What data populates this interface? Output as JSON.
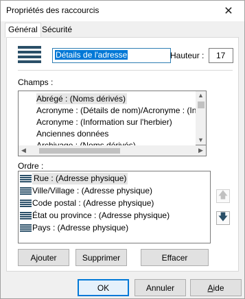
{
  "window": {
    "title": "Propriétés des raccourcis",
    "close_glyph": "✕"
  },
  "tabs": [
    {
      "label": "Général",
      "active": true
    },
    {
      "label": "Sécurité",
      "active": false
    }
  ],
  "general": {
    "name_value": "Détails de l'adresse",
    "height_label": "Hauteur :",
    "height_value": "17",
    "champs_label": "Champs :",
    "champs_items": [
      "Abrégé : (Noms dérivés)",
      "Acronyme : (Détails de nom)/Acronyme : (Inform",
      "Acronyme : (Information sur l'herbier)",
      "Anciennes données",
      "Archivage : (Noms dérivés)"
    ],
    "ordre_label": "Ordre :",
    "ordre_items": [
      "Rue : (Adresse physique)",
      "Ville/Village : (Adresse physique)",
      "Code postal : (Adresse physique)",
      "État ou province : (Adresse physique)",
      "Pays : (Adresse physique)"
    ],
    "add_button": "Ajouter",
    "remove_button": "Supprimer",
    "clear_button": "Effacer"
  },
  "dialog_buttons": {
    "ok": "OK",
    "cancel": "Annuler",
    "help_underlined": "A",
    "help_rest": "ide"
  }
}
